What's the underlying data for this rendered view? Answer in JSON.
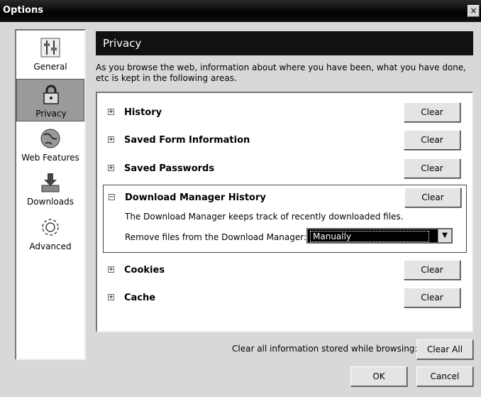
{
  "window": {
    "title": "Options",
    "close_glyph": "×"
  },
  "sidebar": {
    "items": [
      {
        "label": "General",
        "icon": "general-switches-icon",
        "selected": false
      },
      {
        "label": "Privacy",
        "icon": "lock-icon",
        "selected": true
      },
      {
        "label": "Web Features",
        "icon": "globe-icon",
        "selected": false
      },
      {
        "label": "Downloads",
        "icon": "download-tray-icon",
        "selected": false
      },
      {
        "label": "Advanced",
        "icon": "gear-icon",
        "selected": false
      }
    ]
  },
  "panel": {
    "title": "Privacy",
    "description": "As you browse the web, information about where you have been, what you have done, etc is kept in the following areas.",
    "items": [
      {
        "name": "History",
        "button": "Clear",
        "expand_glyph": "+"
      },
      {
        "name": "Saved Form Information",
        "button": "Clear",
        "expand_glyph": "+"
      },
      {
        "name": "Saved Passwords",
        "button": "Clear",
        "expand_glyph": "+"
      },
      {
        "name": "Download Manager History",
        "button": "Clear",
        "expand_glyph": "−"
      },
      {
        "name": "Cookies",
        "button": "Clear",
        "expand_glyph": "+"
      },
      {
        "name": "Cache",
        "button": "Clear",
        "expand_glyph": "+"
      }
    ],
    "download_detail": {
      "text": "The Download Manager keeps track of recently downloaded files.",
      "remove_label": "Remove files from the Download Manager:",
      "remove_value": "Manually"
    }
  },
  "footer": {
    "clear_all_label": "Clear all information stored while browsing:",
    "clear_all_button": "Clear All",
    "ok_button": "OK",
    "cancel_button": "Cancel"
  }
}
